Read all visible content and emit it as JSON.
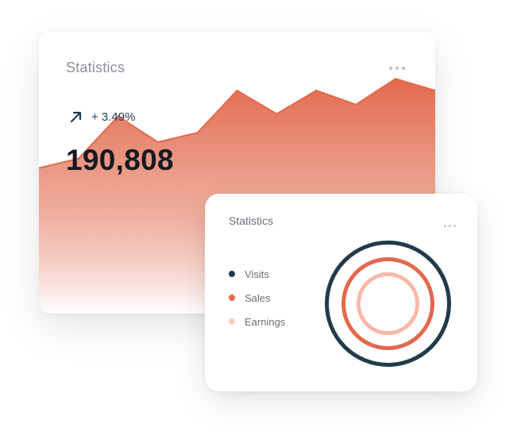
{
  "stats_card": {
    "title": "Statistics",
    "menu_icon": "more-horizontal-icon",
    "trend_icon": "arrow-up-right-icon",
    "trend_text": "+ 3.49%",
    "total_value": "190,808"
  },
  "chart_data": [
    {
      "type": "area",
      "values": [
        62,
        66,
        84,
        73,
        77,
        95,
        85,
        95,
        89,
        100,
        95
      ],
      "ylim": [
        0,
        120
      ],
      "grid": false,
      "color": "#e2694d"
    },
    {
      "type": "ring",
      "series": [
        {
          "name": "Visits",
          "color": "#233a4a"
        },
        {
          "name": "Sales",
          "color": "#e2694d"
        },
        {
          "name": "Earnings",
          "color": "#f9b8a6"
        }
      ]
    }
  ],
  "front_card": {
    "title": "Statistics",
    "menu_icon": "more-horizontal-icon",
    "legend": [
      {
        "label": "Visits",
        "color": "#233a4a"
      },
      {
        "label": "Sales",
        "color": "#e2694d"
      },
      {
        "label": "Earnings",
        "color": "#f9cdbf"
      }
    ]
  },
  "colors": {
    "accent": "#e2694d",
    "dark": "#233a4a",
    "light": "#f9b8a6"
  }
}
